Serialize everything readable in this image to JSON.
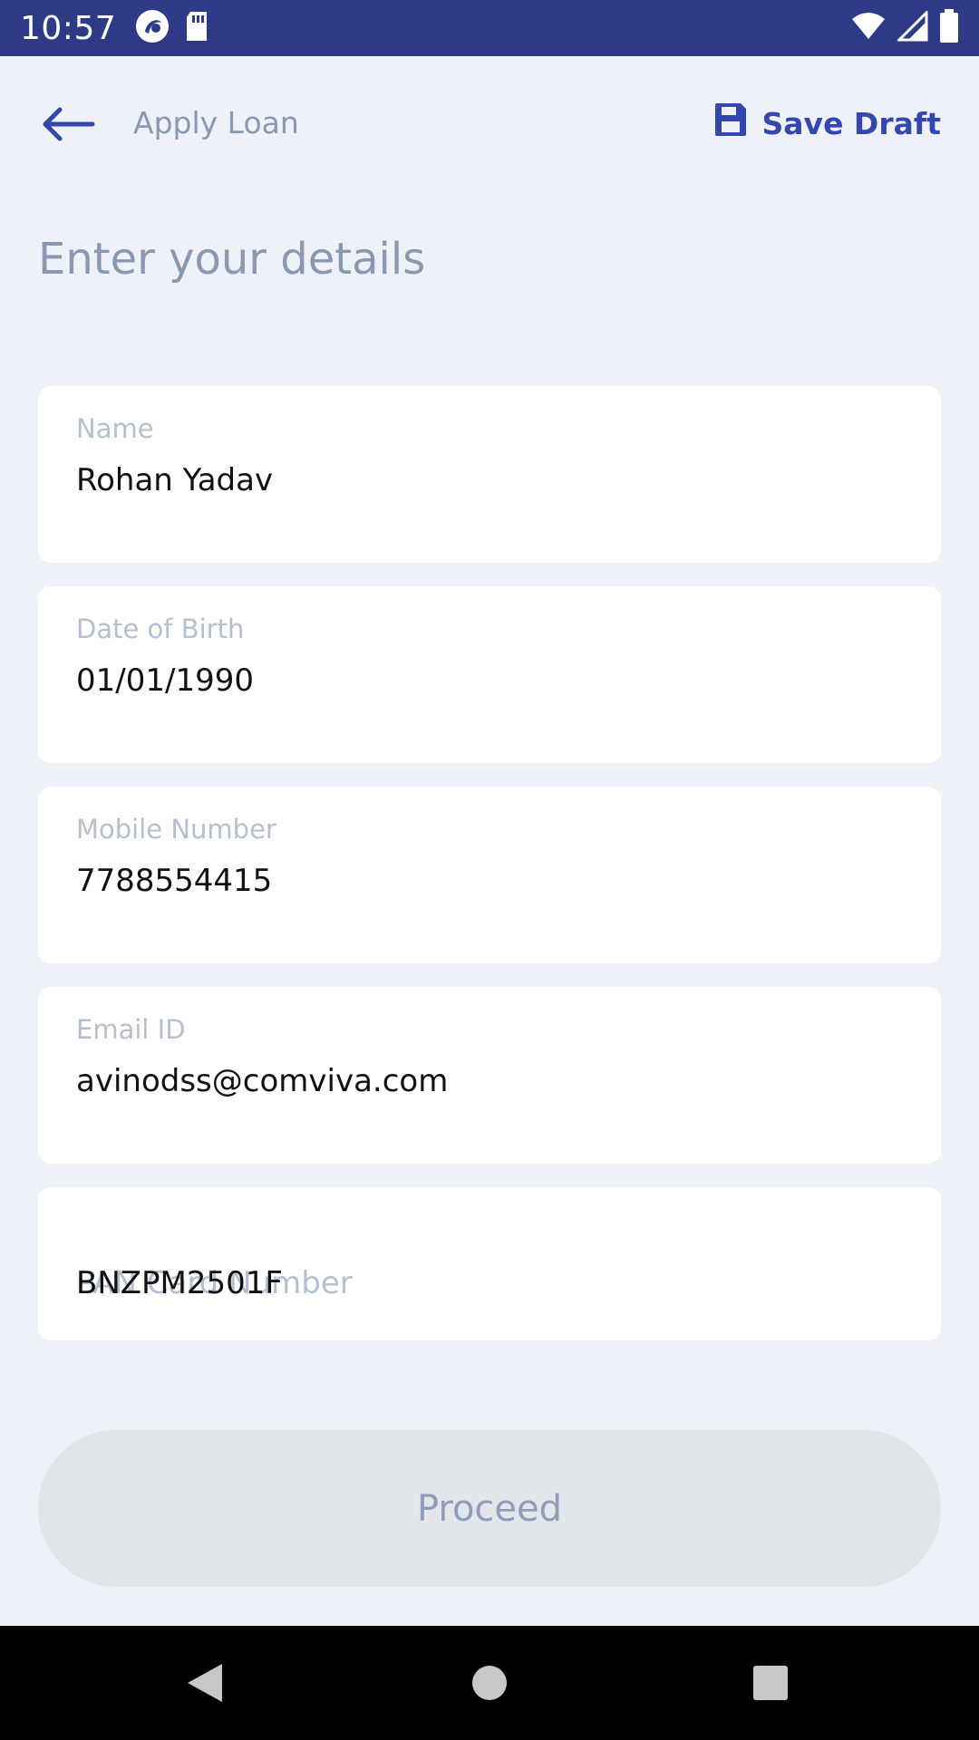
{
  "status_bar": {
    "time": "10:57",
    "icons": [
      "app-notification-icon",
      "sd-card-icon",
      "wifi-icon",
      "signal-icon",
      "battery-icon"
    ]
  },
  "app_bar": {
    "title": "Apply Loan",
    "save_draft_label": "Save Draft",
    "accent_color": "#3447b0"
  },
  "heading": "Enter your details",
  "form": {
    "fields": [
      {
        "label": "Name",
        "value": "Rohan Yadav"
      },
      {
        "label": "Date of Birth",
        "value": "01/01/1990"
      },
      {
        "label": "Mobile Number",
        "value": "7788554415"
      },
      {
        "label": "Email ID",
        "value": "avinodss@comviva.com"
      },
      {
        "label": "PAN Card Number",
        "value": "BNZPM2501F"
      }
    ]
  },
  "proceed_button": {
    "label": "Proceed",
    "enabled": false
  },
  "nav_bar": {
    "buttons": [
      "back",
      "home",
      "recents"
    ]
  }
}
